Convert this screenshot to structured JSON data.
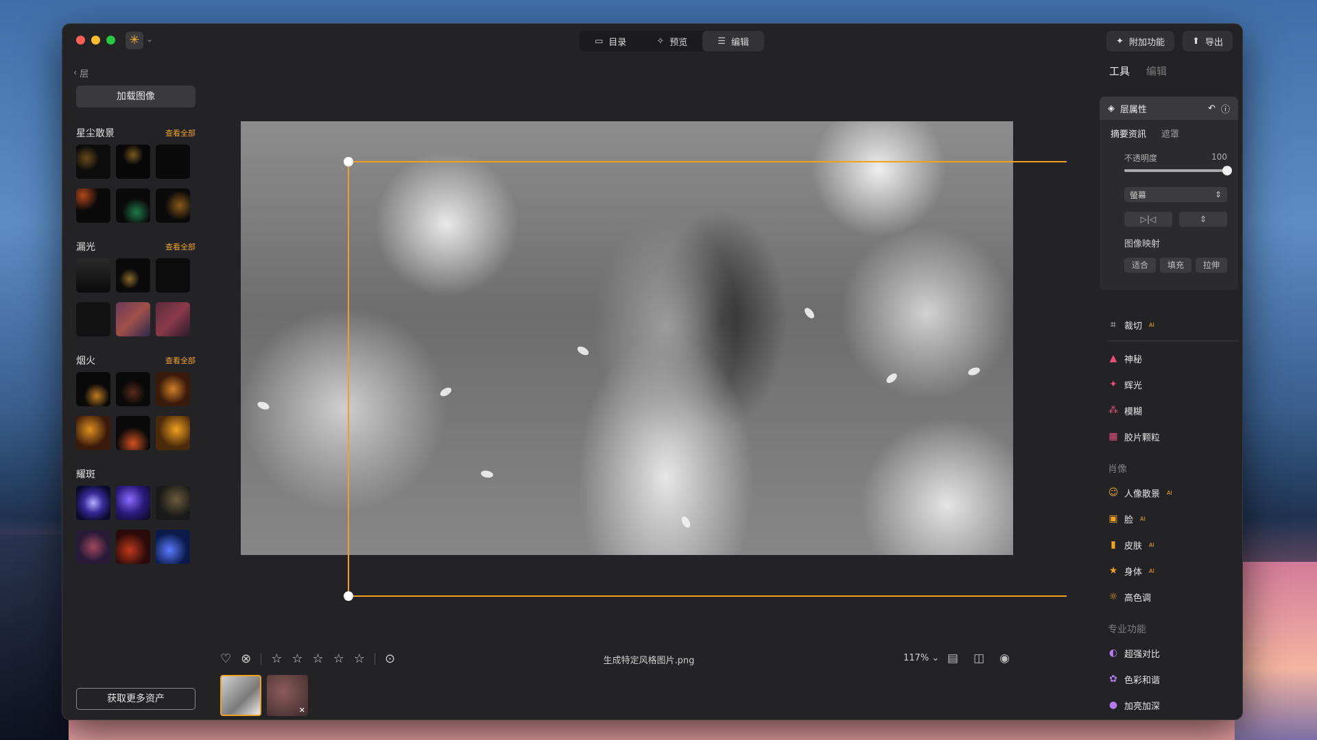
{
  "titlebar": {
    "nav": [
      {
        "label": "目录",
        "icon": "folder-icon"
      },
      {
        "label": "预览",
        "icon": "sparkle-icon"
      },
      {
        "label": "编辑",
        "icon": "sliders-icon"
      }
    ],
    "extras_label": "附加功能",
    "export_label": "导出"
  },
  "left": {
    "back_label": "层",
    "load_label": "加载图像",
    "sections": [
      {
        "title": "星尘散景",
        "link": "查看全部"
      },
      {
        "title": "漏光",
        "link": "查看全部"
      },
      {
        "title": "烟火",
        "link": "查看全部"
      },
      {
        "title": "耀斑",
        "link": ""
      }
    ],
    "get_more_label": "获取更多资产"
  },
  "bottom": {
    "filename": "生成特定风格图片.png",
    "zoom": "117%",
    "rating": 0
  },
  "right": {
    "tab_tools": "工具",
    "tab_edit": "编辑",
    "layer_props": {
      "title": "层属性",
      "sub_summary": "摘要资訊",
      "sub_mask": "遮罩",
      "opacity_label": "不透明度",
      "opacity_value": "100",
      "blend_mode": "螢幕",
      "flip_h": "▷|◁",
      "flip_v": "⇕",
      "mapping_label": "图像映射",
      "map_fit": "适合",
      "map_fill": "填充",
      "map_stretch": "拉伸"
    },
    "crop_label": "裁切",
    "tools_a": [
      {
        "label": "神秘",
        "icon": "mystic-icon",
        "color": "#e94e7a"
      },
      {
        "label": "辉光",
        "icon": "glow-icon",
        "color": "#e94e7a"
      },
      {
        "label": "模糊",
        "icon": "blur-icon",
        "color": "#e94e7a"
      },
      {
        "label": "胶片颗粒",
        "icon": "film-grain-icon",
        "color": "#e94e7a"
      }
    ],
    "group_portrait": "肖像",
    "tools_portrait": [
      {
        "label": "人像散景",
        "icon": "portrait-bokeh-icon"
      },
      {
        "label": "脸",
        "icon": "face-icon"
      },
      {
        "label": "皮肤",
        "icon": "skin-icon"
      },
      {
        "label": "身体",
        "icon": "body-icon"
      },
      {
        "label": "高色调",
        "icon": "high-key-icon"
      }
    ],
    "group_pro": "专业功能",
    "tools_pro": [
      {
        "label": "超强对比",
        "icon": "contrast-icon"
      },
      {
        "label": "色彩和谐",
        "icon": "color-harmony-icon"
      },
      {
        "label": "加亮加深",
        "icon": "dodge-burn-icon"
      }
    ]
  }
}
